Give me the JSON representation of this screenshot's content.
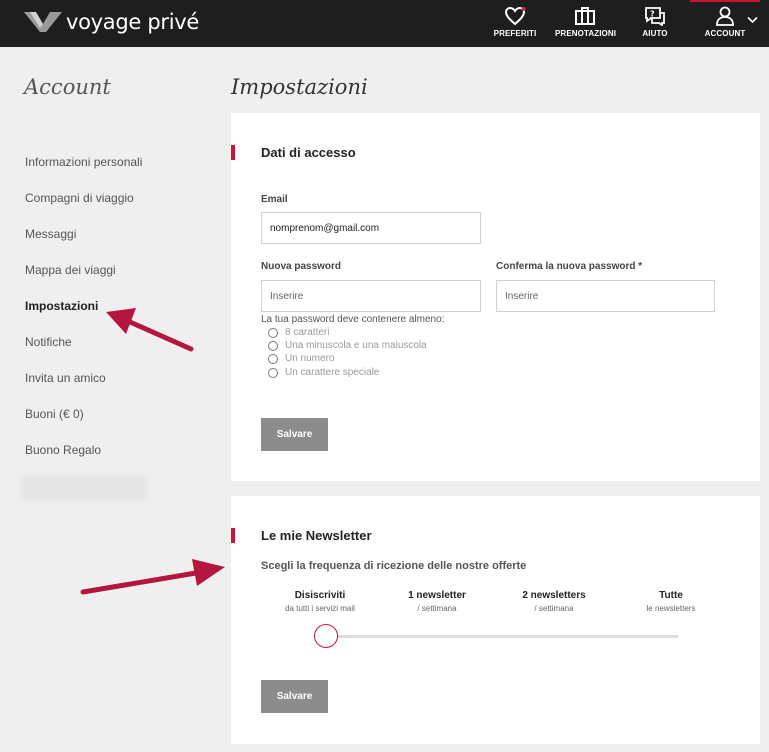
{
  "header": {
    "logo_text": "voyage privé",
    "nav": [
      {
        "label": "PREFERITI",
        "icon": "heart-icon"
      },
      {
        "label": "PRENOTAZIONI",
        "icon": "suitcase-icon"
      },
      {
        "label": "AIUTO",
        "icon": "help-chat-icon"
      },
      {
        "label": "ACCOUNT",
        "icon": "user-icon"
      }
    ],
    "accent_color": "#c4153c"
  },
  "sidebar": {
    "title": "Account",
    "items": [
      {
        "label": "Informazioni personali"
      },
      {
        "label": "Compagni di viaggio"
      },
      {
        "label": "Messaggi"
      },
      {
        "label": "Mappa dei viaggi"
      },
      {
        "label": "Impostazioni",
        "active": true
      },
      {
        "label": "Notifiche"
      },
      {
        "label": "Invita un amico"
      },
      {
        "label": "Buoni (€ 0)"
      },
      {
        "label": "Buono Regalo"
      }
    ]
  },
  "main": {
    "title": "Impostazioni",
    "access": {
      "title": "Dati di accesso",
      "email_label": "Email",
      "email_value": "nomprenom@gmail.com",
      "new_password_label": "Nuova password",
      "new_password_placeholder": "Inserire",
      "confirm_password_label": "Conferma la nuova password *",
      "confirm_password_placeholder": "Inserire",
      "hint": "La tua password deve contenere almeno:",
      "requirements": [
        "8 caratteri",
        "Una minuscola e una maiuscola",
        "Un numero",
        "Un carattere speciale"
      ],
      "save_label": "Salvare"
    },
    "newsletter": {
      "title": "Le mie Newsletter",
      "question": "Scegli la frequenza di ricezione delle nostre offerte",
      "options": [
        {
          "title": "Disiscriviti",
          "subtitle": "da tutti i servizi mail"
        },
        {
          "title": "1 newsletter",
          "subtitle": "/ settimana"
        },
        {
          "title": "2 newsletters",
          "subtitle": "/ settimana"
        },
        {
          "title": "Tutte",
          "subtitle": "le newsletters"
        }
      ],
      "selected_option_index": 0,
      "save_label": "Salvare"
    }
  }
}
